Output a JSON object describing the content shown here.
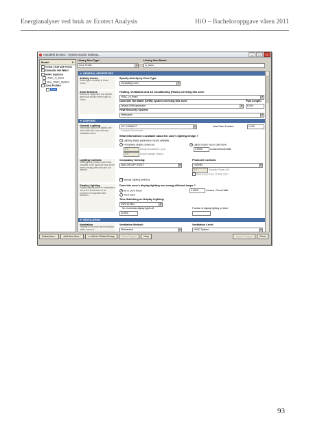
{
  "page_header": {
    "left": "Energianalyser ved bruk av Ecotect Analysis",
    "right": "HiO – Bacheloroppgave våren 2011"
  },
  "page_number": "93",
  "window": {
    "title": "Autodesk Ecotect - System Export Settings...",
    "tree": {
      "header": "Model",
      "nodes": [
        {
          "label": "Comb. Heat and Power",
          "level": 0,
          "bold": true
        },
        {
          "label": "Domestic Hot Water",
          "level": 0,
          "bold": true
        },
        {
          "label": "HVAC Systems",
          "level": 0,
          "bold": true
        },
        {
          "label": "HVAC_rs_leses",
          "level": 1
        },
        {
          "label": "New_HVAC_System",
          "level": 1
        },
        {
          "label": "Zone Profiles",
          "level": 0,
          "bold": true
        },
        {
          "label": "Zone",
          "level": 2,
          "selected": true
        }
      ]
    },
    "library_item_type": {
      "label": "Library Item Type:",
      "value": "Zone Profile"
    },
    "library_item_name": {
      "label": "Library Item Name:",
      "value": "rs_leses"
    },
    "sections": {
      "general": "GENERAL PROPERTIES",
      "lighting": "LIGHTING",
      "ventilation": "VENTILATION"
    },
    "activity": {
      "title": "Activity Levels",
      "desc": "Select type of activity in these zones.",
      "label": "Specify Activity by Zone Type:",
      "value": "Consulting room"
    },
    "zone_services": {
      "title": "Zone Services",
      "desc": "Select the equipment and system types that service these types of zones.",
      "hvac_label": "Heating, Ventilation and Air Conditioning (HVAC) servicing this zone:",
      "hvac_value": "HVAC_rs_leses",
      "dhw_label": "Domestic Hot Water (DHW) system servicing this zone:",
      "dhw_value": "Default DHW generator",
      "pipe_label": "Pipe Length:",
      "pipe_value": "6.000",
      "heat_recovery_label": "Heat Recovery System:",
      "heat_recovery_value": "Heat pipes"
    },
    "general_lighting": {
      "title": "General Lighting",
      "desc": "Information about the lights to be used within the zone and any installation items",
      "value": "CIF-COMPACT",
      "value2": "Compact Fluorescent",
      "heat_frac_label": "Heat Gains Fraction:",
      "heat_frac_value": "0.000",
      "question": "What information is available about the zone's lighting design ?",
      "opt1": "Lighting design parameters not yet available.",
      "opt2": "Full lighting design carried out",
      "opt3": "Lights chosen but no calm done",
      "field1_value": "0.0",
      "field1_label": "Design Illuminance (Lux)",
      "field2_value": "4.0000",
      "field2_label": "Lumens/Circuit Watt",
      "field3_value": "0.0",
      "field3_label": "Actual wattage (Watts)"
    },
    "lighting_controls": {
      "title": "Lighting Controls",
      "desc": "What lighting controls have been provided, to be lights are and will be sense energy when they are not needed.",
      "occupancy_label": "Occupancy Sensing:",
      "occupancy_value": "MAN-ON-OFF-EXIST",
      "photocell_label": "Photocell Controls:",
      "photocell_value": "<NONE>",
      "photocell_field_value": "0.0",
      "photocell_field_label": "Parasitic Power (W)",
      "photocell_check": "Sensor(s) in front of Weir cells ?",
      "manual_label": "Manual Lighting Switches"
    },
    "display_lighting": {
      "title": "Display Lighting",
      "desc": "Display lighting refers to installations where the illumination is for purposes of inspection and selection.",
      "question": "Does this zone's display lighting use energy efficient lamps ?",
      "opt_no": "No or Don't Know",
      "opt_yes": "Yes it does",
      "efficacy_value": "4.0000",
      "efficacy_label": "Lumens / Circuit Watt",
      "time_label": "Time Switching on Display Lighting:",
      "time_value": "SWITCHING",
      "hours_label": "No. hours/day display lights off:",
      "hours_value": "22.000",
      "fraction_label": "Fraction of display lighting on timer:"
    },
    "ventilation": {
      "title": "Ventilation",
      "desc": "Settings for air flows and ventilation within zones of",
      "method_label": "Ventilation Method:",
      "method_value": "Mechanical",
      "level_label": "Ventilation Level:",
      "level_value": "HVAC System"
    },
    "buttons": {
      "delete": "Delete Item...",
      "add_new": "Add New Item...",
      "add_global": "<< Add to Global Library",
      "select_targets": "Select Targets",
      "help": "Help",
      "apply": "Apply Changes",
      "close": "Close"
    }
  }
}
